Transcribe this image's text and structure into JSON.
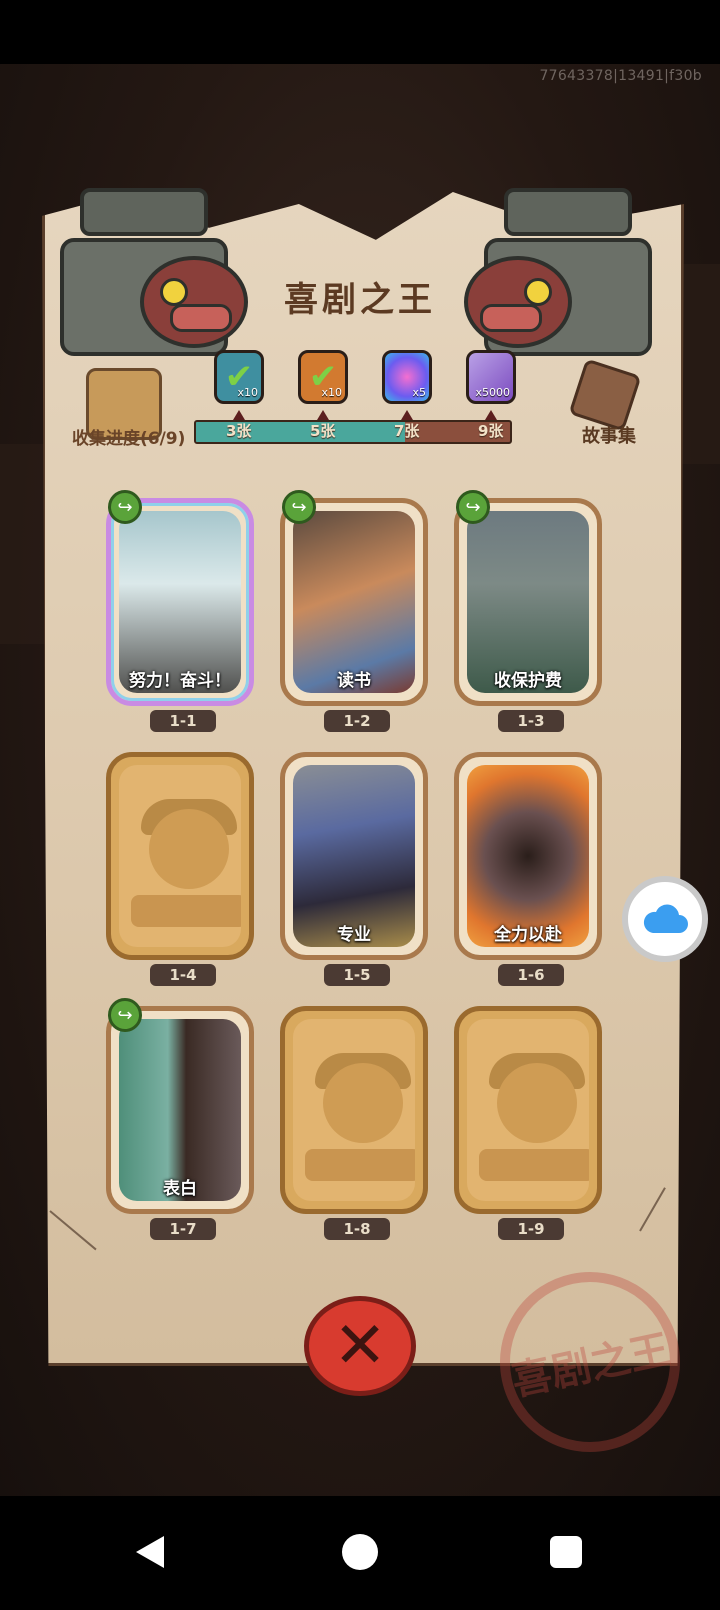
{
  "build_id": "77643378|13491|f30b",
  "title": "喜剧之王",
  "collection": {
    "progress_label": "收集进度(6/9)",
    "story_label": "故事集",
    "progress_fraction": 0.6667
  },
  "rewards": [
    {
      "icon": "green-card-icon",
      "qty": "x10",
      "milestone": "3张",
      "claimed": true
    },
    {
      "icon": "orange-card-icon",
      "qty": "x10",
      "milestone": "5张",
      "claimed": true
    },
    {
      "icon": "swirl-gem-icon",
      "qty": "x5",
      "milestone": "7张",
      "claimed": false
    },
    {
      "icon": "crystal-icon",
      "qty": "x5000",
      "milestone": "9张",
      "claimed": false
    }
  ],
  "cards": [
    {
      "code": "1-1",
      "name": "努力！奋斗！",
      "unlocked": true,
      "shareable": true,
      "rare": true
    },
    {
      "code": "1-2",
      "name": "读书",
      "unlocked": true,
      "shareable": true,
      "rare": false
    },
    {
      "code": "1-3",
      "name": "收保护费",
      "unlocked": true,
      "shareable": true,
      "rare": false
    },
    {
      "code": "1-4",
      "name": "",
      "unlocked": false,
      "shareable": false,
      "rare": false
    },
    {
      "code": "1-5",
      "name": "专业",
      "unlocked": true,
      "shareable": false,
      "rare": false
    },
    {
      "code": "1-6",
      "name": "全力以赴",
      "unlocked": true,
      "shareable": false,
      "rare": false
    },
    {
      "code": "1-7",
      "name": "表白",
      "unlocked": true,
      "shareable": true,
      "rare": false
    },
    {
      "code": "1-8",
      "name": "",
      "unlocked": false,
      "shareable": false,
      "rare": false
    },
    {
      "code": "1-9",
      "name": "",
      "unlocked": false,
      "shareable": false,
      "rare": false
    }
  ],
  "stamp_text": "喜剧之王",
  "colors": {
    "progress_fill": "#4aa79c",
    "progress_track": "#8b4f3d",
    "close_button": "#d83b2f",
    "cloud": "#3b9ef0"
  }
}
